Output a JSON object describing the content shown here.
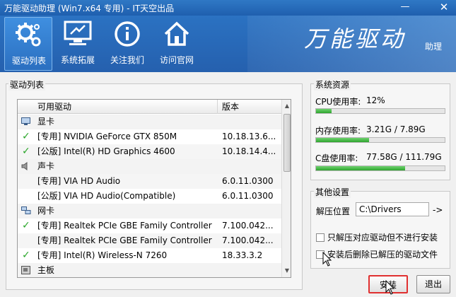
{
  "window": {
    "title": "万能驱动助理 (Win7.x64 专用) - IT天空出品",
    "minimize_glyph": "—",
    "close_glyph": "✕"
  },
  "toolbar": {
    "items": [
      {
        "label": "驱动列表",
        "icon": "gear-icon",
        "active": true
      },
      {
        "label": "系统拓展",
        "icon": "monitor-icon",
        "active": false
      },
      {
        "label": "关注我们",
        "icon": "info-icon",
        "active": false
      },
      {
        "label": "访问官网",
        "icon": "home-icon",
        "active": false
      }
    ],
    "brand_title": "万能驱动",
    "brand_subtitle": "助理"
  },
  "driver_list": {
    "group_title": "驱动列表",
    "columns": [
      "可用驱动",
      "版本"
    ],
    "rows": [
      {
        "kind": "category",
        "name": "显卡",
        "version": "",
        "checked": false,
        "icon": "display-card-icon"
      },
      {
        "kind": "item",
        "name": "[专用] NVIDIA GeForce GTX 850M",
        "version": "10.18.13.6...",
        "checked": true
      },
      {
        "kind": "item",
        "name": "[公版] Intel(R) HD Graphics 4600",
        "version": "10.18.14.4...",
        "checked": true
      },
      {
        "kind": "category",
        "name": "声卡",
        "version": "",
        "checked": false,
        "icon": "speaker-icon"
      },
      {
        "kind": "item",
        "name": "[专用] VIA HD Audio",
        "version": "6.0.11.0300",
        "checked": false
      },
      {
        "kind": "item",
        "name": "[公版] VIA HD Audio(Compatible)",
        "version": "6.0.11.0300",
        "checked": false
      },
      {
        "kind": "category",
        "name": "网卡",
        "version": "",
        "checked": false,
        "icon": "network-icon"
      },
      {
        "kind": "item",
        "name": "[专用] Realtek PCIe GBE Family Controller",
        "version": "7.100.042...",
        "checked": true
      },
      {
        "kind": "item",
        "name": "[专用] Realtek PCIe GBE Family Controller",
        "version": "7.100.042...",
        "checked": false
      },
      {
        "kind": "item",
        "name": "[专用] Intel(R) Wireless-N 7260",
        "version": "18.33.3.2",
        "checked": true
      },
      {
        "kind": "category",
        "name": "主板",
        "version": "",
        "checked": false,
        "icon": "motherboard-icon"
      }
    ]
  },
  "system_resources": {
    "group_title": "系统资源",
    "cpu": {
      "label": "CPU使用率:",
      "value": "12%",
      "fraction": 0.12
    },
    "memory": {
      "label": "内存使用率:",
      "value": "3.21G / 7.89G",
      "fraction": 0.41
    },
    "disk": {
      "label": "C盘使用率:",
      "value": "77.58G / 111.79G",
      "fraction": 0.69
    }
  },
  "other_settings": {
    "group_title": "其他设置",
    "unzip_label": "解压位置",
    "unzip_path": "C:\\Drivers",
    "browse_label": "->",
    "option1": "只解压对应驱动但不进行安装",
    "option2": "安装后删除已解压的驱动文件"
  },
  "buttons": {
    "install": "安装",
    "exit": "退出"
  },
  "colors": {
    "titlebar": "#2f78c5",
    "check": "#2aa62a",
    "progress": "#2ea42e",
    "install_highlight": "#e03030"
  }
}
